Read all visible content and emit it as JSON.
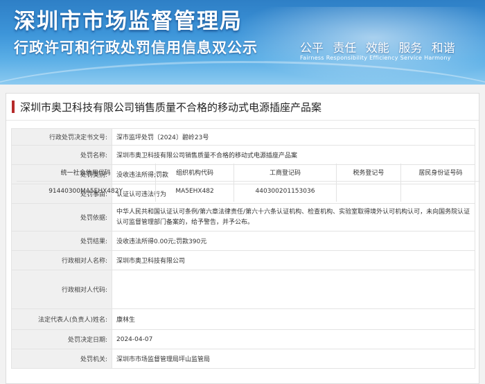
{
  "banner": {
    "title_main": "深圳市市场监督管理局",
    "title_sub": "行政许可和行政处罚信用信息双公示",
    "slogan": [
      "公平",
      "责任",
      "效能",
      "服务",
      "和谐"
    ],
    "slogan_en": "Fairness  Responsibility  Efficiency  Service  Harmony"
  },
  "case": {
    "title": "深圳市奥卫科技有限公司销售质量不合格的移动式电源插座产品案"
  },
  "fields": {
    "decision_no_label": "行政处罚决定书文号:",
    "decision_no": "深市监坪处罚〔2024〕碧岭23号",
    "name_label": "处罚名称:",
    "name": "深圳市奥卫科技有限公司销售质量不合格的移动式电源插座产品案",
    "category_label": "处罚类别:",
    "category": "没收违法所得;罚款",
    "reason_label": "处罚事由:",
    "reason": "认证认可违法行为",
    "basis_label": "处罚依据:",
    "basis": "中华人民共和国认证认可条例/第六章法律责任/第六十六条认证机构、检查机构、实验室取得境外认可机构认可，未向国务院认证认可监督管理部门备案的，给予警告，并予公布。",
    "result_label": "处罚结果:",
    "result": "没收违法所得0.00元;罚款390元",
    "party_label": "行政相对人名称:",
    "party": "深圳市奥卫科技有限公司",
    "code_label": "行政相对人代码:",
    "legal_rep_label": "法定代表人(负责人)姓名:",
    "legal_rep": "康林生",
    "date_label": "处罚决定日期:",
    "date": "2024-04-07",
    "authority_label": "处罚机关:",
    "authority": "深圳市市场监督管理局坪山监管局"
  },
  "codes": {
    "headers": [
      "统一社会信用代码",
      "组织机构代码",
      "工商登记码",
      "税务登记号",
      "居民身份证号码"
    ],
    "values": [
      "91440300MA5EHX482Y",
      "MA5EHX482",
      "440300201153036",
      "",
      ""
    ]
  }
}
